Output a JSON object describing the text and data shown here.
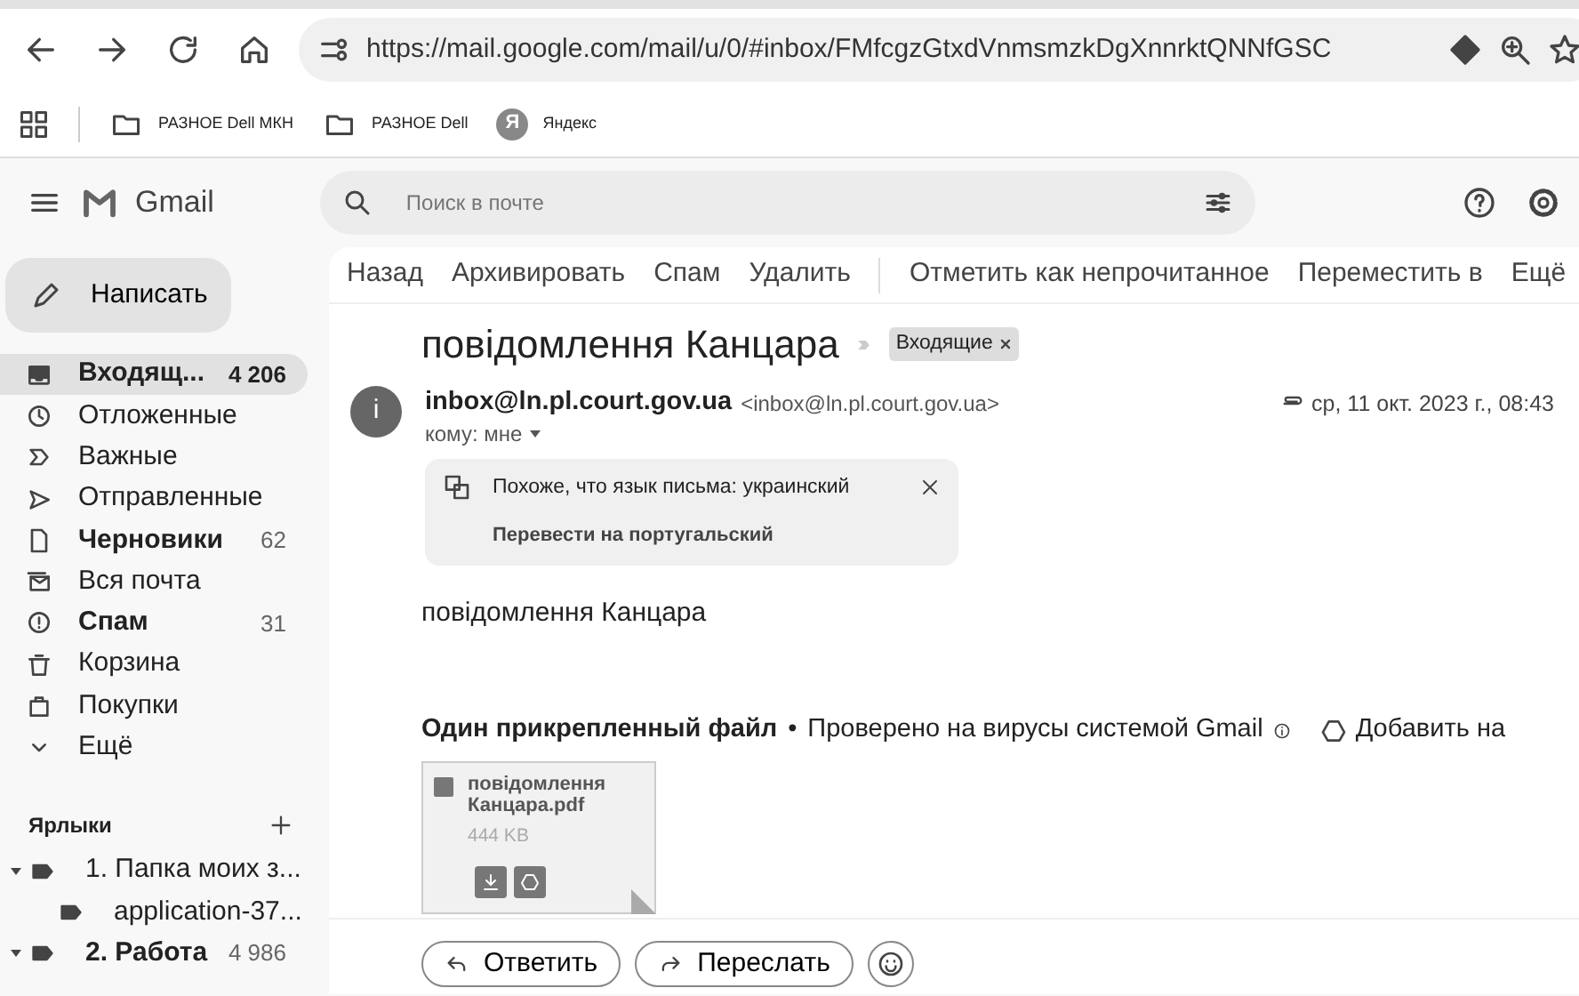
{
  "browser": {
    "url": "https://mail.google.com/mail/u/0/#inbox/FMfcgzGtxdVnmsmzkDgXnnrktQNNfGSC",
    "bookmarks": [
      {
        "kind": "folder",
        "label": "РАЗНОЕ Dell МКН"
      },
      {
        "kind": "folder",
        "label": "РАЗНОЕ Dell"
      },
      {
        "kind": "site",
        "label": "Яндекс",
        "icon_letter": "Я"
      }
    ]
  },
  "header": {
    "app_name": "Gmail",
    "search": {
      "placeholder": "Поиск в почте"
    }
  },
  "compose": "Написать",
  "sidebar": {
    "items": [
      {
        "kind": "inbox",
        "label": "Входящ...",
        "count": "4 206",
        "bold": true,
        "selected": true
      },
      {
        "kind": "snoozed",
        "label": "Отложенные",
        "bold": false,
        "selected": false
      },
      {
        "kind": "important",
        "label": "Важные",
        "bold": false,
        "selected": false
      },
      {
        "kind": "sent",
        "label": "Отправленные",
        "bold": false,
        "selected": false
      },
      {
        "kind": "drafts",
        "label": "Черновики",
        "count": "62",
        "bold": true,
        "selected": false
      },
      {
        "kind": "all",
        "label": "Вся почта",
        "bold": false,
        "selected": false
      },
      {
        "kind": "spam",
        "label": "Спам",
        "count": "31",
        "bold": true,
        "selected": false
      },
      {
        "kind": "trash",
        "label": "Корзина",
        "bold": false,
        "selected": false
      },
      {
        "kind": "shopping",
        "label": "Покупки",
        "bold": false,
        "selected": false
      },
      {
        "kind": "more",
        "label": "Ещё",
        "bold": false,
        "selected": false
      }
    ],
    "labels_title": "Ярлыки",
    "labels": [
      {
        "label": "1. Папка моих з...",
        "bold": false,
        "expanded": true,
        "children": [
          {
            "label": "application-37..."
          }
        ]
      },
      {
        "label": "2. Работа",
        "count": "4 986",
        "bold": true,
        "expanded": true
      }
    ]
  },
  "toolbar": [
    "Назад",
    "Архивировать",
    "Спам",
    "Удалить",
    "Отметить как непрочитанное",
    "Переместить в",
    "Ещё"
  ],
  "message": {
    "subject": "повідомлення Канцара",
    "label_chip": "Входящие",
    "avatar_letter": "i",
    "sender_name": "inbox@ln.pl.court.gov.ua",
    "sender_email": "<inbox@ln.pl.court.gov.ua>",
    "recipient": "кому: мне",
    "has_attachment": true,
    "date": "ср, 11 окт. 2023 г., 08:43",
    "translate": {
      "text": "Похоже, что язык письма: украинский",
      "link": "Перевести на португальский"
    },
    "body": "повідомлення Канцара",
    "attachments_title": "Один прикрепленный файл",
    "separator": "•",
    "scan_note": "Проверено на вирусы системой Gmail",
    "add_to": "Добавить на",
    "attachments": [
      {
        "name": "повідомлення Канцара.pdf",
        "size": "444 KB"
      }
    ],
    "actions": [
      "Ответить",
      "Переслать"
    ]
  }
}
